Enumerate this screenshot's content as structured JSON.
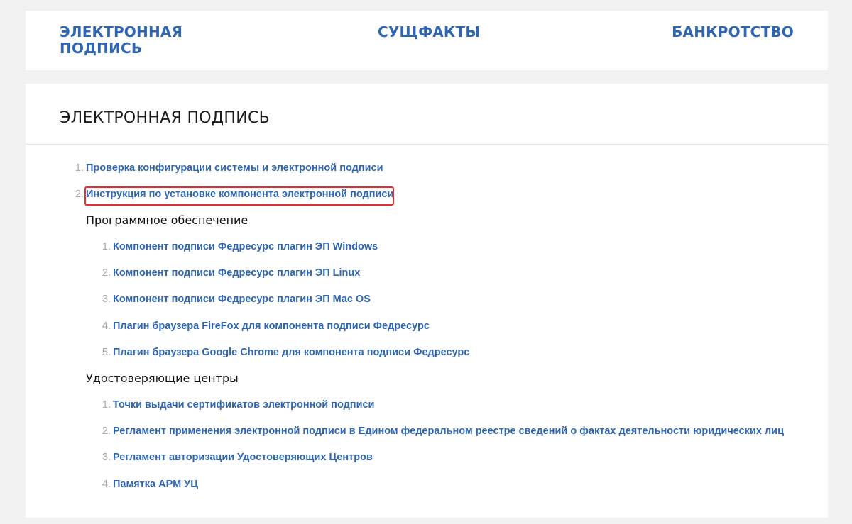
{
  "nav": {
    "items": [
      {
        "label": "ЭЛЕКТРОННАЯ ПОДПИСЬ"
      },
      {
        "label": "СУЩФАКТЫ"
      },
      {
        "label": "БАНКРОТСТВО"
      }
    ]
  },
  "main": {
    "title": "ЭЛЕКТРОННАЯ ПОДПИСЬ",
    "top_list": [
      {
        "num": "1.",
        "label": "Проверка конфигурации системы и электронной подписи"
      },
      {
        "num": "2.",
        "label": "Инструкция по установке компонента электронной подписи"
      }
    ],
    "sections": [
      {
        "heading": "Программное обеспечение",
        "items": [
          {
            "num": "1.",
            "label": "Компонент подписи Федресурс плагин ЭП Windows"
          },
          {
            "num": "2.",
            "label": "Компонент подписи Федресурс плагин ЭП Linux"
          },
          {
            "num": "3.",
            "label": "Компонент подписи Федресурс плагин ЭП Mac OS"
          },
          {
            "num": "4.",
            "label": "Плагин браузера FireFox для компонента подписи Федресурс"
          },
          {
            "num": "5.",
            "label": "Плагин браузера Google Chrome для компонента подписи Федресурс"
          }
        ]
      },
      {
        "heading": "Удостоверяющие центры",
        "items": [
          {
            "num": "1.",
            "label": "Точки выдачи сертификатов электронной подписи"
          },
          {
            "num": "2.",
            "label": "Регламент применения электронной подписи в Едином федеральном реестре сведений о фактах деятельности юридических лиц"
          },
          {
            "num": "3.",
            "label": "Регламент авторизации Удостоверяющих Центров"
          },
          {
            "num": "4.",
            "label": "Памятка АРМ УЦ"
          }
        ]
      }
    ]
  },
  "colors": {
    "link": "#2f66b3",
    "number": "#a8a8a8",
    "highlight": "#e0302f",
    "background": "#f2f2f2"
  }
}
